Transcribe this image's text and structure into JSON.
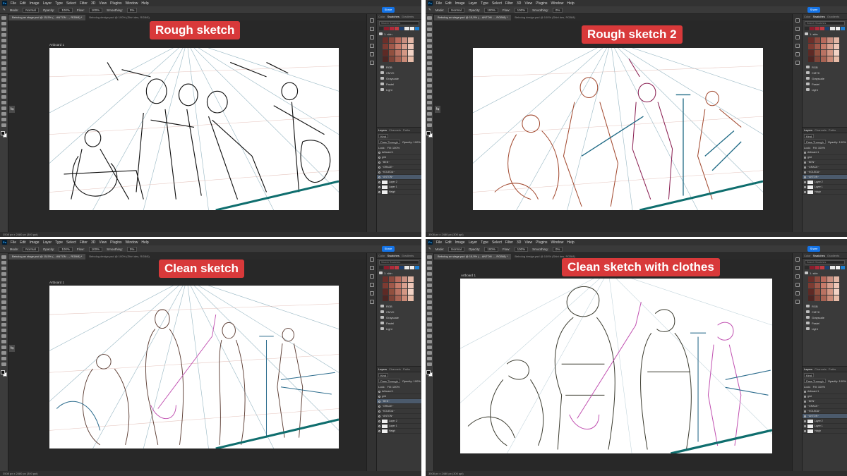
{
  "app": {
    "menu": [
      "File",
      "Edit",
      "Image",
      "Layer",
      "Type",
      "Select",
      "Filter",
      "3D",
      "View",
      "Plugins",
      "Window",
      "Help"
    ],
    "share_label": "Share",
    "options": {
      "mode_label": "Mode:",
      "mode_value": "Normal",
      "opacity_label": "Opacity:",
      "opacity_value": "100%",
      "flow_label": "Flow:",
      "flow_value": "100%",
      "smoothing_label": "Smoothing:",
      "smoothing_value": "0%"
    },
    "tabs": [
      "Bebolog av stage.psd @ 15,5% (... ANTON ..., RGB/8) *",
      "Bebolog design.psd @ 100% (Shirt des, RGB/8)"
    ],
    "artboard_label": "Artboard 1",
    "status_text": "3508 px x 2480 px (300 ppi)",
    "panel_tabs": [
      "Color",
      "Swatches",
      "Gradients",
      "Patterns"
    ],
    "search_placeholder": "Search Swatches",
    "skin_group": "1. skin",
    "swatch_folders": [
      "RGB",
      "CMYK",
      "Grayscale",
      "Pastel",
      "Light"
    ],
    "layer_tabs": [
      "Layers",
      "Channels",
      "Paths"
    ],
    "layer_kind": "Kind",
    "layer_blend": "Pass Through",
    "layer_opacity": "Opacity: 100%",
    "layer_lock": "Lock:",
    "layer_fill": "Fill: 100%",
    "layers": [
      "Artboard 1",
      "grid",
      "~BEN~",
      "~GRACE~",
      "~KOLEDA~",
      "~ANTON~",
      "Layer 2",
      "Layer 1",
      "Haigh"
    ]
  },
  "colors": {
    "label_bg": "#d8393a",
    "teal_line": "#0f6e6e",
    "skin_swatches": [
      "#6b2f2a",
      "#8c4a3f",
      "#b86a5c",
      "#c98f80",
      "#e3b7a6",
      "#7d3b32",
      "#a0584a",
      "#c77b6a",
      "#d9a08f",
      "#efc7b8",
      "#5e2a25",
      "#91503f",
      "#b97262",
      "#d39784",
      "#f2d2c4",
      "#4d2623",
      "#7f4438",
      "#a86353",
      "#ca8a77",
      "#e8bda9"
    ],
    "recent_swatches": [
      "#2a2a2a",
      "#8b1c2c",
      "#b0293a",
      "#c23a42",
      "#1c3e6e",
      "#e8e8e8",
      "#f0f0f0",
      "#1d7fd1"
    ]
  },
  "panels": [
    {
      "label": "Rough sketch"
    },
    {
      "label": "Rough sketch 2"
    },
    {
      "label": "Clean sketch"
    },
    {
      "label": "Clean sketch with clothes"
    }
  ]
}
